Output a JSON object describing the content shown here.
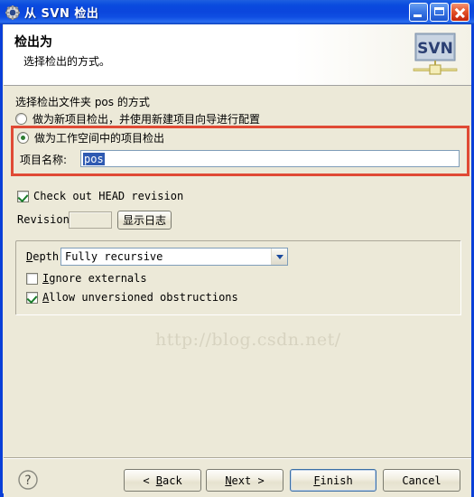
{
  "window": {
    "title": "从 SVN 检出",
    "icon": "gear-icon",
    "controls": {
      "minimize": "最小化",
      "maximize": "最大化",
      "close": "关闭"
    }
  },
  "header": {
    "title": "检出为",
    "subtitle": "选择检出的方式。",
    "logo_text": "SVN"
  },
  "content": {
    "instruction": "选择检出文件夹 pos 的方式",
    "folder_name": "pos",
    "radios": [
      {
        "label": "做为新项目检出，并使用新建项目向导进行配置",
        "selected": false
      },
      {
        "label": "做为工作空间中的项目检出",
        "selected": true
      }
    ],
    "project_name": {
      "label": "项目名称:",
      "value": "pos",
      "selected": true
    },
    "head_revision": {
      "label": "Check out HEAD revision",
      "checked": true
    },
    "revision": {
      "label": "Revision:",
      "value": "",
      "enabled": false
    },
    "show_log_button": "显示日志",
    "depth": {
      "label": "Depth:",
      "mnemonic": "D",
      "value": "Fully recursive"
    },
    "ignore_externals": {
      "label": "Ignore externals",
      "mnemonic": "I",
      "checked": false
    },
    "allow_unversioned": {
      "label": "Allow unversioned obstructions",
      "mnemonic": "A",
      "checked": true
    },
    "watermark": "http://blog.csdn.net/",
    "annotation_color": "#e04a35"
  },
  "footer": {
    "help": "?",
    "back": "< Back",
    "back_mnemonic": "B",
    "next": "Next >",
    "next_mnemonic": "N",
    "finish": "Finish",
    "finish_mnemonic": "F",
    "cancel": "Cancel"
  }
}
